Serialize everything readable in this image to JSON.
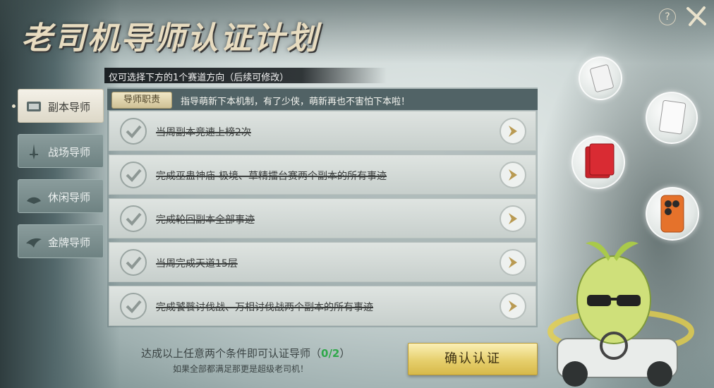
{
  "title": "老司机导师认证计划",
  "subtitle": "仅可选择下方的1个赛道方向（后续可修改）",
  "help_label": "?",
  "sidebar": {
    "items": [
      {
        "label": "副本导师",
        "icon": "scroll-icon",
        "active": true
      },
      {
        "label": "战场导师",
        "icon": "sword-icon",
        "active": false
      },
      {
        "label": "休闲导师",
        "icon": "fan-icon",
        "active": false
      },
      {
        "label": "金牌导师",
        "icon": "bird-icon",
        "active": false
      }
    ]
  },
  "duty": {
    "badge": "导师职责",
    "text": "指导萌新下本机制，有了少侠，萌新再也不害怕下本啦！"
  },
  "tasks": [
    {
      "text": "当周副本竞速上榜2次"
    },
    {
      "text": "完成巫蛊神庙-极境、草精擂台赛两个副本的所有事迹"
    },
    {
      "text": "完成轮回副本全部事迹"
    },
    {
      "text": "当周完成天道15层"
    },
    {
      "text": "完成饕餮讨伐战、万相讨伐战两个副本的所有事迹"
    }
  ],
  "footer": {
    "condition_prefix": "达成以上任意两个条件即可认证导师（",
    "progress": "0/2",
    "condition_suffix": "）",
    "hint": "如果全部都满足那更是超级老司机！"
  },
  "confirm_label": "确认认证",
  "colors": {
    "progress": "#2fa84a",
    "confirm": "#e6cf6c"
  }
}
